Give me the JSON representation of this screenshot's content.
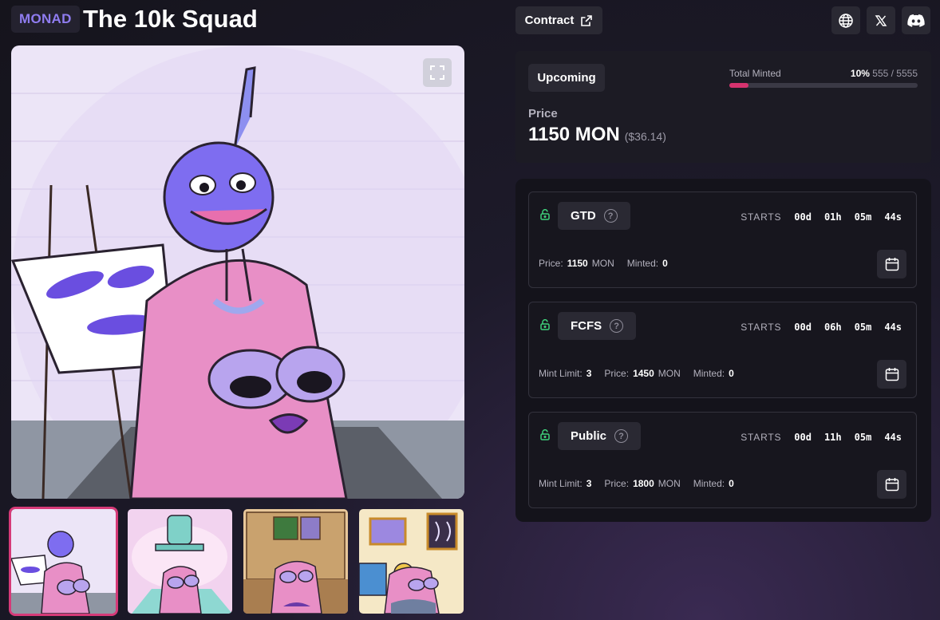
{
  "header": {
    "chain_badge": "MONAD",
    "title": "The 10k Squad",
    "contract_label": "Contract",
    "social_icons": [
      "globe-icon",
      "x-icon",
      "discord-icon"
    ]
  },
  "gallery": {
    "thumbnails": [
      "owl-with-blue-creature",
      "owl-with-jar",
      "owl-in-shop",
      "owl-with-paintings"
    ],
    "active_index": 0
  },
  "mint_card": {
    "status": "Upcoming",
    "total_minted_label": "Total Minted",
    "progress_percent": "10%",
    "progress_fraction": 0.1,
    "minted_count": "555 / 5555",
    "price_label": "Price",
    "price": "1150 MON",
    "price_usd": "($36.14)"
  },
  "phases": [
    {
      "name": "GTD",
      "starts_label": "STARTS",
      "countdown": [
        "00d",
        "01h",
        "05m",
        "44s"
      ],
      "mint_limit_label": "",
      "mint_limit": "",
      "price_label": "Price:",
      "price": "1150",
      "currency": "MON",
      "minted_label": "Minted:",
      "minted": "0"
    },
    {
      "name": "FCFS",
      "starts_label": "STARTS",
      "countdown": [
        "00d",
        "06h",
        "05m",
        "44s"
      ],
      "mint_limit_label": "Mint Limit:",
      "mint_limit": "3",
      "price_label": "Price:",
      "price": "1450",
      "currency": "MON",
      "minted_label": "Minted:",
      "minted": "0"
    },
    {
      "name": "Public",
      "starts_label": "STARTS",
      "countdown": [
        "00d",
        "11h",
        "05m",
        "44s"
      ],
      "mint_limit_label": "Mint Limit:",
      "mint_limit": "3",
      "price_label": "Price:",
      "price": "1800",
      "currency": "MON",
      "minted_label": "Minted:",
      "minted": "0"
    }
  ],
  "colors": {
    "accent": "#d6336f",
    "chain_badge": "#8f7cf0",
    "unlocked": "#3fd07a"
  }
}
